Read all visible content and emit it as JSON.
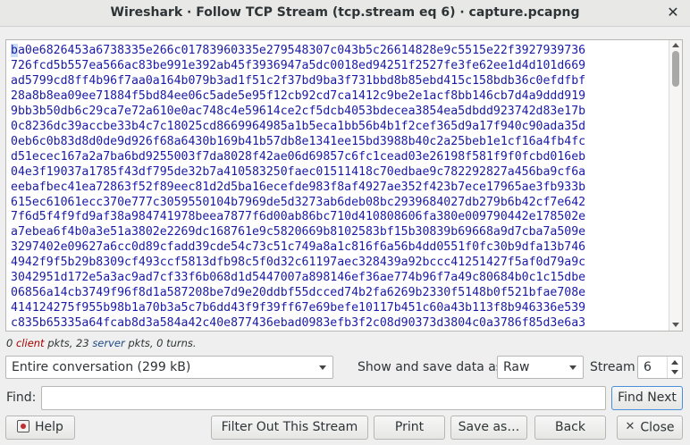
{
  "window": {
    "title": "Wireshark · Follow TCP Stream (tcp.stream eq 6) · capture.pcapng",
    "close_icon": "close-icon"
  },
  "stream": {
    "lines": [
      "ba0e6826453a6738335e266c01783960335e279548307c043b5c26614828e9c5515e22f3927939736",
      "726fcd5b557ea566ac83be991e392ab45f3936947a5dc0018ed94251f2527fe3fe62ee1d4d101d669",
      "ad5799cd8ff4b96f7aa0a164b079b3ad1f51c2f37bd9ba3f731bbd8b85ebd415c158bdb36c0efdfbf",
      "28a8b8ea09ee71884f5bd84ee06c5ade5e95f12cb92cd7ca1412c9be2e1acf8bb146cb7d4a9ddd919",
      "9bb3b50db6c29ca7e72a610e0ac748c4e59614ce2cf5dcb4053bdecea3854ea5dbdd923742d83e17b",
      "0c8236dc39accbe33b4c7c18025cd8669964985a1b5eca1bb56b4b1f2cef365d9a17f940c90ada35d",
      "0eb6c0b83d8d0de9d926f68a6430b169b41b57db8e1341ee15bd3988b40c2a25beb1e1cf16a4fb4fc",
      "d51ecec167a2a7ba6bd9255003f7da8028f42ae06d69857c6fc1cead03e26198f581f9f0fcbd016eb",
      "04e3f19037a1785f43df795de32b7a410583250faec01511418c70edbae9c782292827a456ba9cf6a",
      "eebafbec41ea72863f52f89eec81d2d5ba16ecefde983f8af4927ae352f423b7ece17965ae3fb933b",
      "615ec61061ecc370e777c3059550104b7969de5d3273ab6deb08bc2939684027db279b6b42cf7e642",
      "7f6d5f4f9fd9af38a984741978beea7877f6d00ab86bc710d410808606fa380e009790442e178502e",
      "a7ebea6f4b0a3e51a3802e2269dc168761e9c5820669b8102583bf15b30839b69668a9d7cba7a509e",
      "3297402e09627a6cc0d89cfadd39cde54c73c51c749a8a1c816f6a56b4dd0551f0fc30b9dfa13b746",
      "4942f9f5b29b8309cf493ccf5813dfb98c5f0d32c61197aec328439a92bccc41251427f5af0d79a9c",
      "3042951d172e5a3ac9ad7cf33f6b068d1d5447007a898146ef36ae774b96f7a49c80684b0c1c15dbe",
      "06856a14cb3749f96f8d1a587208be7d9e20ddbf55dcced74b2fa6269b2330f5148b0f521bfae708e",
      "414124275f955b98b1a70b3a5c7b6dd43f9f39ff67e69befe10117b451c60a43b113f8b946336e539",
      "c835b65335a64fcab8d3a584a42c40e877436ebad0983efb3f2c08d90373d3804c0a3786f85d3e6a3"
    ]
  },
  "stats": {
    "client_count": "0",
    "client_word": "client",
    "pkts1": " pkts, ",
    "server_count": "23",
    "server_word": "server",
    "pkts2": " pkts, 0 turns."
  },
  "controls": {
    "conversation": "Entire conversation (299 kB)",
    "show_label": "Show and save data as",
    "format": "Raw",
    "stream_label": "Stream",
    "stream_value": "6",
    "find_label": "Find:",
    "find_value": "",
    "find_next": "Find Next"
  },
  "buttons": {
    "help": "Help",
    "filter_out": "Filter Out This Stream",
    "print": "Print",
    "save_as": "Save as…",
    "back": "Back",
    "close": "Close"
  }
}
